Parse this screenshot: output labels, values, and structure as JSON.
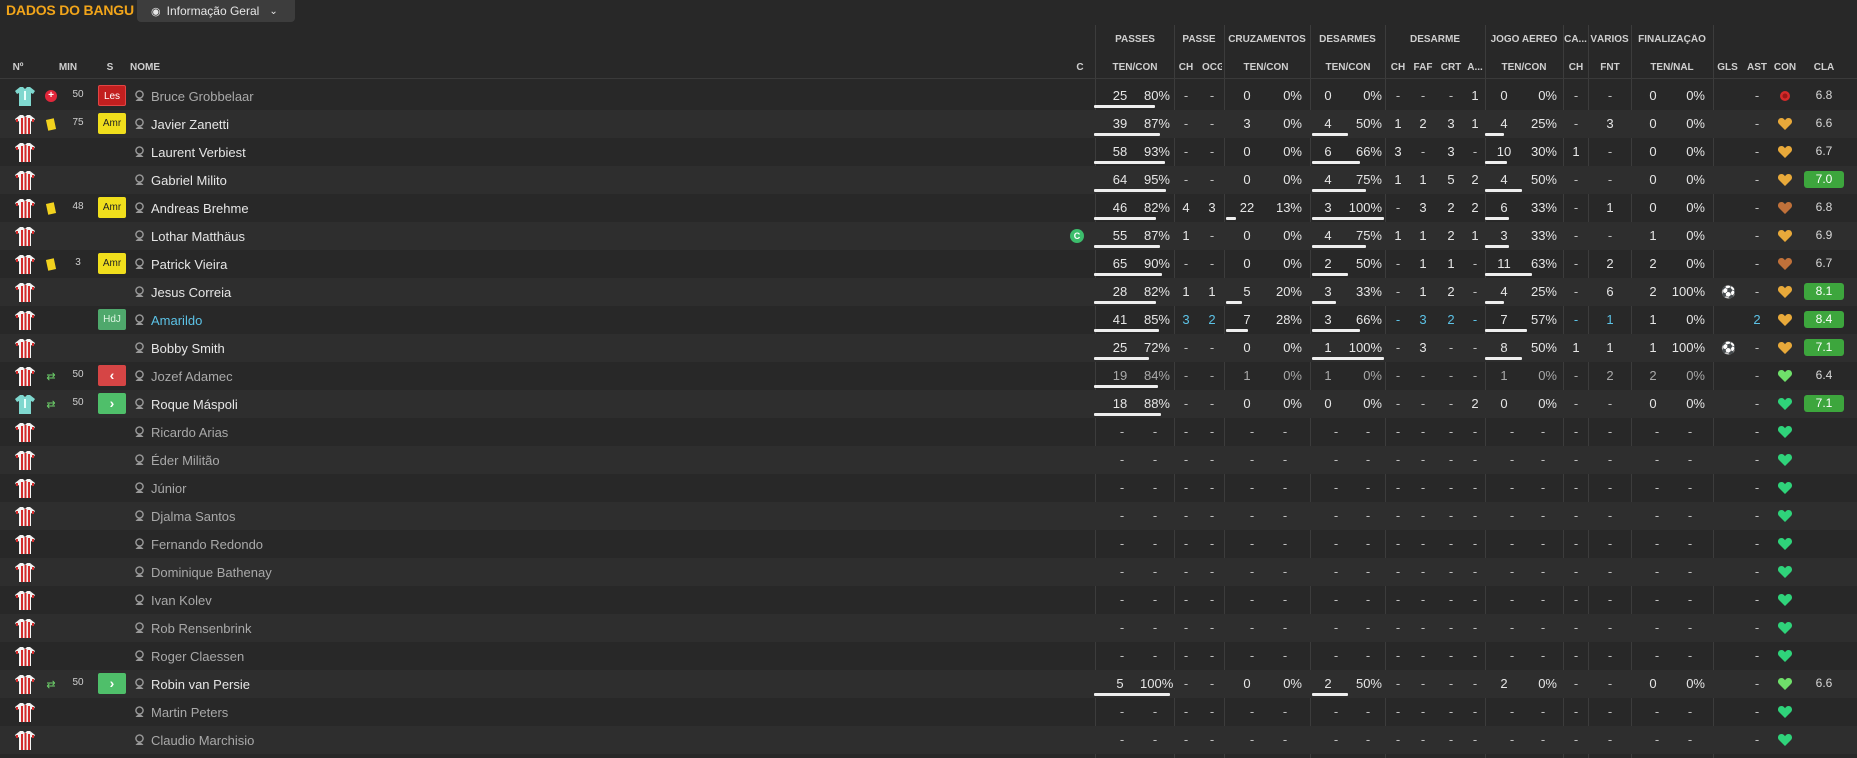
{
  "title": "DADOS DO BANGU",
  "view_selector": {
    "label": "Informação Geral",
    "icon": "eye-icon"
  },
  "colors": {
    "accent": "#f2a51a",
    "highlight": "#5cc2e6",
    "yellow_card": "#f0de1c",
    "injury": "#e2273b",
    "rating_good": "#3da63d"
  },
  "group_headers": [
    "PASSES",
    "PASSE",
    "CRUZAMENTOS",
    "DESARMES",
    "DESARME",
    "JOGO AÉREO",
    "CA...",
    "VÁRIOS",
    "FINALIZAÇÃO"
  ],
  "columns": [
    "Nº",
    "MIN",
    "S",
    "NOME",
    "C",
    "TEN/CON",
    "CH",
    "OCG",
    "TEN/CON",
    "TEN/CON",
    "CH",
    "FAF",
    "CRT",
    "A...",
    "TEN/CON",
    "CH",
    "FNT",
    "TEN/NAL",
    "GLS",
    "AST",
    "CON",
    "CLA"
  ],
  "players": [
    {
      "kit": "gk",
      "event": "injury",
      "min": "50",
      "badge": "Les",
      "name": "Bruce Grobbelaar",
      "tone": "dim",
      "pass": [
        "25",
        "80%"
      ],
      "pass_fill": 0.8,
      "pch": "-",
      "ocg": "-",
      "cross": [
        "0",
        "0%"
      ],
      "cross_fill": 0,
      "tack": [
        "0",
        "0%"
      ],
      "tack_fill": 0,
      "dch": "-",
      "faf": "-",
      "crt": "-",
      "a": "1",
      "aer": [
        "0",
        "0%"
      ],
      "aer_fill": 0,
      "cach": "-",
      "fnt": "-",
      "shot": [
        "0",
        "0%"
      ],
      "gls": "",
      "ast": "-",
      "heart": "red",
      "cla": "6.8",
      "cla_good": false
    },
    {
      "kit": "field",
      "event": "yellow",
      "min": "75",
      "badge": "Amr",
      "name": "Javier Zanetti",
      "pass": [
        "39",
        "87%"
      ],
      "pass_fill": 0.87,
      "pch": "-",
      "ocg": "-",
      "cross": [
        "3",
        "0%"
      ],
      "cross_fill": 0,
      "tack": [
        "4",
        "50%"
      ],
      "tack_fill": 0.5,
      "dch": "1",
      "faf": "2",
      "crt": "3",
      "a": "1",
      "aer": [
        "4",
        "25%"
      ],
      "aer_fill": 0.25,
      "cach": "-",
      "fnt": "3",
      "shot": [
        "0",
        "0%"
      ],
      "gls": "",
      "ast": "-",
      "heart": "orange",
      "cla": "6.6",
      "cla_good": false
    },
    {
      "kit": "field",
      "event": "",
      "min": "",
      "badge": "",
      "name": "Laurent Verbiest",
      "pass": [
        "58",
        "93%"
      ],
      "pass_fill": 0.93,
      "pch": "-",
      "ocg": "-",
      "cross": [
        "0",
        "0%"
      ],
      "cross_fill": 0,
      "tack": [
        "6",
        "66%"
      ],
      "tack_fill": 0.66,
      "dch": "3",
      "faf": "-",
      "crt": "3",
      "a": "-",
      "aer": [
        "10",
        "30%"
      ],
      "aer_fill": 0.3,
      "cach": "1",
      "fnt": "-",
      "shot": [
        "0",
        "0%"
      ],
      "gls": "",
      "ast": "-",
      "heart": "orange",
      "cla": "6.7",
      "cla_good": false
    },
    {
      "kit": "field",
      "event": "",
      "min": "",
      "badge": "",
      "name": "Gabriel Milito",
      "pass": [
        "64",
        "95%"
      ],
      "pass_fill": 0.95,
      "pch": "-",
      "ocg": "-",
      "cross": [
        "0",
        "0%"
      ],
      "cross_fill": 0,
      "tack": [
        "4",
        "75%"
      ],
      "tack_fill": 0.75,
      "dch": "1",
      "faf": "1",
      "crt": "5",
      "a": "2",
      "aer": [
        "4",
        "50%"
      ],
      "aer_fill": 0.5,
      "cach": "-",
      "fnt": "-",
      "shot": [
        "0",
        "0%"
      ],
      "gls": "",
      "ast": "-",
      "heart": "orange",
      "cla": "7.0",
      "cla_good": true
    },
    {
      "kit": "field",
      "event": "yellow",
      "min": "48",
      "badge": "Amr",
      "name": "Andreas Brehme",
      "pass": [
        "46",
        "82%"
      ],
      "pass_fill": 0.82,
      "pch": "4",
      "ocg": "3",
      "cross": [
        "22",
        "13%"
      ],
      "cross_fill": 0.13,
      "tack": [
        "3",
        "100%"
      ],
      "tack_fill": 1,
      "dch": "-",
      "faf": "3",
      "crt": "2",
      "a": "2",
      "aer": [
        "6",
        "33%"
      ],
      "aer_fill": 0.33,
      "cach": "-",
      "fnt": "1",
      "shot": [
        "0",
        "0%"
      ],
      "gls": "",
      "ast": "-",
      "heart": "brown",
      "cla": "6.8",
      "cla_good": false
    },
    {
      "kit": "field",
      "event": "",
      "min": "",
      "badge": "",
      "name": "Lothar Matthäus",
      "captain": "C",
      "pass": [
        "55",
        "87%"
      ],
      "pass_fill": 0.87,
      "pch": "1",
      "ocg": "-",
      "cross": [
        "0",
        "0%"
      ],
      "cross_fill": 0,
      "tack": [
        "4",
        "75%"
      ],
      "tack_fill": 0.75,
      "dch": "1",
      "faf": "1",
      "crt": "2",
      "a": "1",
      "aer": [
        "3",
        "33%"
      ],
      "aer_fill": 0.33,
      "cach": "-",
      "fnt": "-",
      "shot": [
        "1",
        "0%"
      ],
      "gls": "",
      "ast": "-",
      "heart": "orange",
      "cla": "6.9",
      "cla_good": false
    },
    {
      "kit": "field",
      "event": "yellow",
      "min": "3",
      "badge": "Amr",
      "name": "Patrick Vieira",
      "pass": [
        "65",
        "90%"
      ],
      "pass_fill": 0.9,
      "pch": "-",
      "ocg": "-",
      "cross": [
        "0",
        "0%"
      ],
      "cross_fill": 0,
      "tack": [
        "2",
        "50%"
      ],
      "tack_fill": 0.5,
      "dch": "-",
      "faf": "1",
      "crt": "1",
      "a": "-",
      "aer": [
        "11",
        "63%"
      ],
      "aer_fill": 0.63,
      "cach": "-",
      "fnt": "2",
      "shot": [
        "2",
        "0%"
      ],
      "gls": "",
      "ast": "-",
      "heart": "brown",
      "cla": "6.7",
      "cla_good": false
    },
    {
      "kit": "field",
      "event": "",
      "min": "",
      "badge": "",
      "name": "Jesus Correia",
      "pass": [
        "28",
        "82%"
      ],
      "pass_fill": 0.82,
      "pch": "1",
      "ocg": "1",
      "cross": [
        "5",
        "20%"
      ],
      "cross_fill": 0.2,
      "tack": [
        "3",
        "33%"
      ],
      "tack_fill": 0.33,
      "dch": "-",
      "faf": "1",
      "crt": "2",
      "a": "-",
      "aer": [
        "4",
        "25%"
      ],
      "aer_fill": 0.25,
      "cach": "-",
      "fnt": "6",
      "shot": [
        "2",
        "100%"
      ],
      "gls": "ball",
      "ast": "-",
      "heart": "orange",
      "cla": "8.1",
      "cla_good": true
    },
    {
      "kit": "field",
      "event": "",
      "min": "",
      "badge": "HdJ",
      "name": "Amarildo",
      "tone": "hl",
      "pass": [
        "41",
        "85%"
      ],
      "pass_fill": 0.85,
      "pch": "3",
      "ocg": "2",
      "cross": [
        "7",
        "28%"
      ],
      "cross_fill": 0.28,
      "tack": [
        "3",
        "66%"
      ],
      "tack_fill": 0.66,
      "dch": "-",
      "faf": "3",
      "crt": "2",
      "a": "-",
      "aer": [
        "7",
        "57%"
      ],
      "aer_fill": 0.57,
      "cach": "-",
      "fnt": "1",
      "shot": [
        "1",
        "0%"
      ],
      "gls": "",
      "ast": "2",
      "heart": "orange",
      "cla": "8.4",
      "cla_good": true,
      "blue": true
    },
    {
      "kit": "field",
      "event": "",
      "min": "",
      "badge": "",
      "name": "Bobby Smith",
      "pass": [
        "25",
        "72%"
      ],
      "pass_fill": 0.72,
      "pch": "-",
      "ocg": "-",
      "cross": [
        "0",
        "0%"
      ],
      "cross_fill": 0,
      "tack": [
        "1",
        "100%"
      ],
      "tack_fill": 1,
      "dch": "-",
      "faf": "3",
      "crt": "-",
      "a": "-",
      "aer": [
        "8",
        "50%"
      ],
      "aer_fill": 0.5,
      "cach": "1",
      "fnt": "1",
      "shot": [
        "1",
        "100%"
      ],
      "gls": "ball",
      "ast": "-",
      "heart": "orange",
      "cla": "7.1",
      "cla_good": true
    },
    {
      "kit": "field",
      "event": "subs",
      "min": "50",
      "badge": "off",
      "name": "Jozef Adamec",
      "tone": "dim",
      "pass": [
        "19",
        "84%"
      ],
      "pass_fill": 0.84,
      "pch": "-",
      "ocg": "-",
      "cross": [
        "1",
        "0%"
      ],
      "cross_fill": 0,
      "tack": [
        "1",
        "0%"
      ],
      "tack_fill": 0,
      "dch": "-",
      "faf": "-",
      "crt": "-",
      "a": "-",
      "aer": [
        "1",
        "0%"
      ],
      "aer_fill": 0,
      "cach": "-",
      "fnt": "2",
      "shot": [
        "2",
        "0%"
      ],
      "gls": "",
      "ast": "-",
      "heart": "lime",
      "cla": "6.4",
      "cla_good": false,
      "dimvals": true
    },
    {
      "kit": "gk",
      "event": "subs",
      "min": "50",
      "badge": "on",
      "name": "Roque Máspoli",
      "pass": [
        "18",
        "88%"
      ],
      "pass_fill": 0.88,
      "pch": "-",
      "ocg": "-",
      "cross": [
        "0",
        "0%"
      ],
      "cross_fill": 0,
      "tack": [
        "0",
        "0%"
      ],
      "tack_fill": 0,
      "dch": "-",
      "faf": "-",
      "crt": "-",
      "a": "2",
      "aer": [
        "0",
        "0%"
      ],
      "aer_fill": 0,
      "cach": "-",
      "fnt": "-",
      "shot": [
        "0",
        "0%"
      ],
      "gls": "",
      "ast": "-",
      "heart": "green",
      "cla": "7.1",
      "cla_good": true
    },
    {
      "kit": "field",
      "name": "Ricardo Arias",
      "tone": "dim",
      "bench": true
    },
    {
      "kit": "field",
      "name": "Éder Militão",
      "tone": "dim",
      "bench": true
    },
    {
      "kit": "field",
      "name": "Júnior",
      "tone": "dim",
      "bench": true
    },
    {
      "kit": "field",
      "name": "Djalma Santos",
      "tone": "dim",
      "bench": true
    },
    {
      "kit": "field",
      "name": "Fernando Redondo",
      "tone": "dim",
      "bench": true
    },
    {
      "kit": "field",
      "name": "Dominique Bathenay",
      "tone": "dim",
      "bench": true
    },
    {
      "kit": "field",
      "name": "Ivan Kolev",
      "tone": "dim",
      "bench": true
    },
    {
      "kit": "field",
      "name": "Rob Rensenbrink",
      "tone": "dim",
      "bench": true
    },
    {
      "kit": "field",
      "name": "Roger Claessen",
      "tone": "dim",
      "bench": true
    },
    {
      "kit": "field",
      "event": "subs",
      "min": "50",
      "badge": "on",
      "name": "Robin van Persie",
      "pass": [
        "5",
        "100%"
      ],
      "pass_fill": 1,
      "pch": "-",
      "ocg": "-",
      "cross": [
        "0",
        "0%"
      ],
      "cross_fill": 0,
      "tack": [
        "2",
        "50%"
      ],
      "tack_fill": 0.5,
      "dch": "-",
      "faf": "-",
      "crt": "-",
      "a": "-",
      "aer": [
        "2",
        "0%"
      ],
      "aer_fill": 0,
      "cach": "-",
      "fnt": "-",
      "shot": [
        "0",
        "0%"
      ],
      "gls": "",
      "ast": "-",
      "heart": "lime",
      "cla": "6.6",
      "cla_good": false
    },
    {
      "kit": "field",
      "name": "Martin Peters",
      "tone": "dim",
      "bench": true
    },
    {
      "kit": "field",
      "name": "Claudio Marchisio",
      "tone": "dim",
      "bench": true
    }
  ]
}
